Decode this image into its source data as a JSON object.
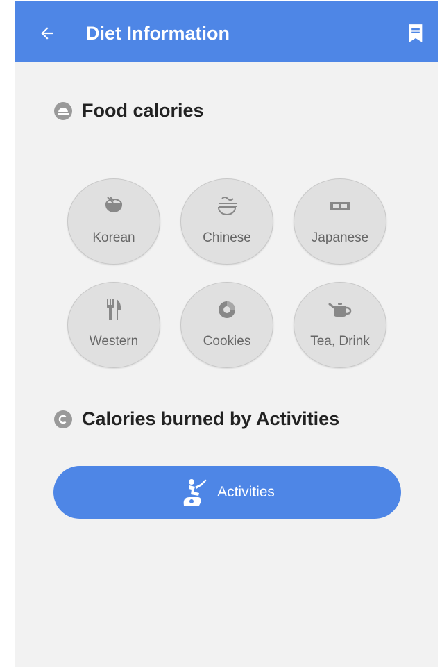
{
  "appbar": {
    "title": "Diet Information",
    "back_icon": "arrow-left-icon",
    "bookmark_icon": "bookmark-icon",
    "background": "#4e86e6"
  },
  "food_section": {
    "title": "Food calories",
    "icon": "plate-cover-icon",
    "items": [
      {
        "label": "Korean",
        "icon": "rice-bowl-icon"
      },
      {
        "label": "Chinese",
        "icon": "noodle-bowl-icon"
      },
      {
        "label": "Japanese",
        "icon": "bento-box-icon"
      },
      {
        "label": "Western",
        "icon": "fork-knife-icon"
      },
      {
        "label": "Cookies",
        "icon": "donut-icon"
      },
      {
        "label": "Tea, Drink",
        "icon": "teapot-icon"
      }
    ]
  },
  "activity_section": {
    "title": "Calories burned by Activities",
    "icon": "letter-c-icon",
    "button_label": "Activities",
    "button_icon": "exercise-bike-icon",
    "accent": "#4e86e6"
  }
}
